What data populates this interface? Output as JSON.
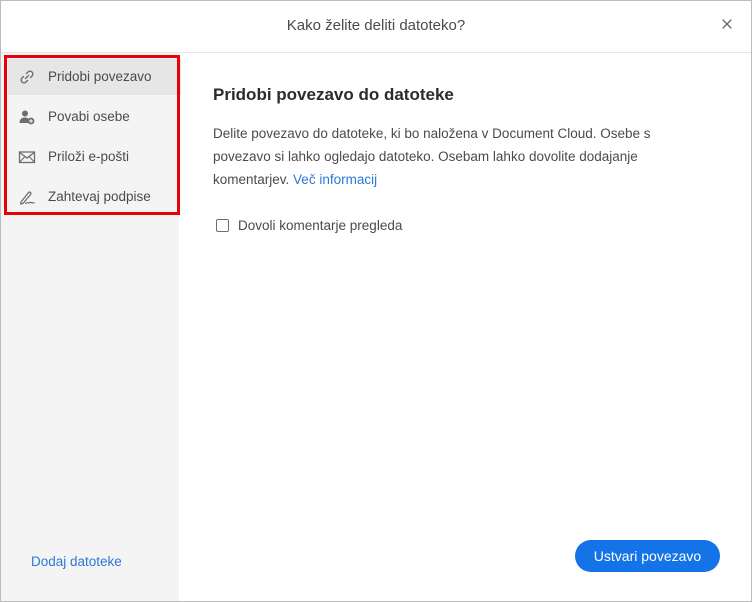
{
  "dialog": {
    "title": "Kako želite deliti datoteko?",
    "close_icon": "close-icon"
  },
  "sidebar": {
    "items": [
      {
        "label": "Pridobi povezavo",
        "icon": "link-icon",
        "active": true
      },
      {
        "label": "Povabi osebe",
        "icon": "add-person-icon",
        "active": false
      },
      {
        "label": "Priloži e-pošti",
        "icon": "envelope-icon",
        "active": false
      },
      {
        "label": "Zahtevaj podpise",
        "icon": "signature-icon",
        "active": false
      }
    ],
    "add_files": "Dodaj datoteke"
  },
  "content": {
    "title": "Pridobi povezavo do datoteke",
    "description": "Delite povezavo do datoteke, ki bo naložena v Document Cloud. Osebe s povezavo si lahko ogledajo datoteko. Osebam lahko dovolite dodajanje komentarjev.",
    "more_info": "Več informacij",
    "checkbox_label": "Dovoli komentarje pregleda",
    "checkbox_checked": false
  },
  "footer": {
    "primary_button": "Ustvari povezavo"
  },
  "colors": {
    "accent": "#1473e6",
    "link": "#2d78d4",
    "highlight_border": "#e8000b",
    "sidebar_bg": "#f4f4f4"
  }
}
